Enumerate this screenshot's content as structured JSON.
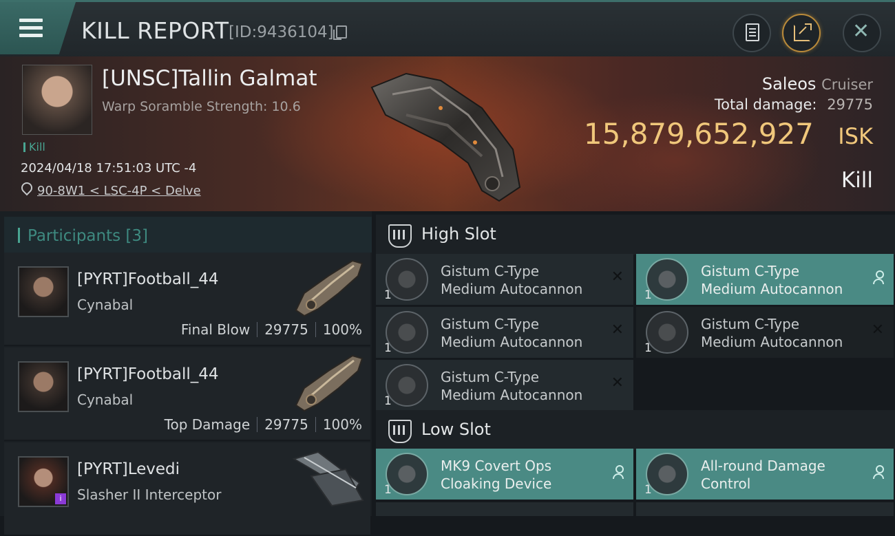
{
  "header": {
    "title": "KILL REPORT",
    "report_id": "[ID:9436104]"
  },
  "victim": {
    "name": "[UNSC]Tallin Galmat",
    "warp_scramble": "Warp Soramble Strength: 10.6",
    "tag": "Kill",
    "datetime": "2024/04/18 17:51:03 UTC -4",
    "location": "90-8W1 < LSC-4P < Delve",
    "ship": "Saleos",
    "ship_class": "Cruiser",
    "total_damage_label": "Total damage:",
    "total_damage": "29775",
    "isk_value": "15,879,652,927",
    "isk_unit": "ISK",
    "result": "Kill"
  },
  "participants": {
    "title": "Participants [3]",
    "rows": [
      {
        "name": "[PYRT]Football_44",
        "ship": "Cynabal",
        "role": "Final Blow",
        "damage": "29775",
        "percent": "100%"
      },
      {
        "name": "[PYRT]Football_44",
        "ship": "Cynabal",
        "role": "Top Damage",
        "damage": "29775",
        "percent": "100%"
      },
      {
        "name": "[PYRT]Levedi",
        "ship": "Slasher II Interceptor",
        "badge": "i"
      }
    ]
  },
  "slots": {
    "high": {
      "label": "High Slot",
      "modules": [
        {
          "line1": "Gistum C-Type",
          "line2": "Medium Autocannon",
          "qty": "1"
        },
        {
          "line1": "Gistum C-Type",
          "line2": "Medium Autocannon",
          "qty": "1"
        },
        {
          "line1": "Gistum C-Type",
          "line2": "Medium Autocannon",
          "qty": "1"
        },
        {
          "line1": "Gistum C-Type",
          "line2": "Medium Autocannon",
          "qty": "1"
        },
        {
          "line1": "Gistum C-Type",
          "line2": "Medium Autocannon",
          "qty": "1"
        }
      ]
    },
    "low": {
      "label": "Low Slot",
      "modules": [
        {
          "line1": "MK9 Covert Ops",
          "line2": "Cloaking Device",
          "qty": "1"
        },
        {
          "line1": "All-round Damage",
          "line2": "Control",
          "qty": "1"
        }
      ]
    }
  },
  "colors": {
    "accent": "#49a592",
    "isk": "#f0c77b",
    "fitted": "#4a8a84"
  }
}
